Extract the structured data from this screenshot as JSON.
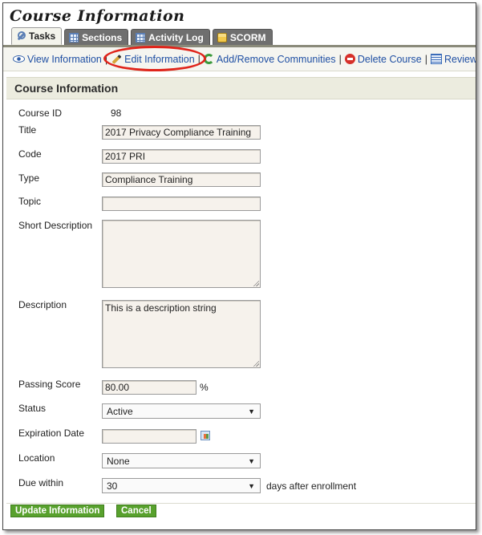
{
  "app_title": "Course Information",
  "tabs": [
    {
      "label": "Tasks",
      "icon": "wrench-icon",
      "active": true
    },
    {
      "label": "Sections",
      "icon": "grid-icon",
      "active": false
    },
    {
      "label": "Activity Log",
      "icon": "grid-icon",
      "active": false
    },
    {
      "label": "SCORM",
      "icon": "box-icon",
      "active": false
    }
  ],
  "toolbar": {
    "view_information": "View Information",
    "edit_information": "Edit Information",
    "add_remove_communities": "Add/Remove Communities",
    "delete_course": "Delete Course",
    "review": "Review",
    "separator": "|"
  },
  "section": {
    "title": "Course Information"
  },
  "form": {
    "course_id_label": "Course ID",
    "course_id_value": "98",
    "title_label": "Title",
    "title_value": "2017 Privacy Compliance Training",
    "code_label": "Code",
    "code_value": "2017 PRI",
    "type_label": "Type",
    "type_value": "Compliance Training",
    "topic_label": "Topic",
    "topic_value": "",
    "short_description_label": "Short Description",
    "short_description_value": "",
    "description_label": "Description",
    "description_value": "This is a description string",
    "passing_score_label": "Passing Score",
    "passing_score_value": "80.00",
    "passing_score_unit": "%",
    "status_label": "Status",
    "status_value": "Active",
    "expiration_date_label": "Expiration Date",
    "expiration_date_value": "",
    "location_label": "Location",
    "location_value": "None",
    "due_within_label": "Due within",
    "due_within_value": "30",
    "due_within_suffix": "days after enrollment"
  },
  "buttons": {
    "update": "Update Information",
    "cancel": "Cancel"
  },
  "colors": {
    "highlight_ring": "#e0241b",
    "button_green": "#58a12d",
    "link_blue": "#1f4fa3"
  }
}
